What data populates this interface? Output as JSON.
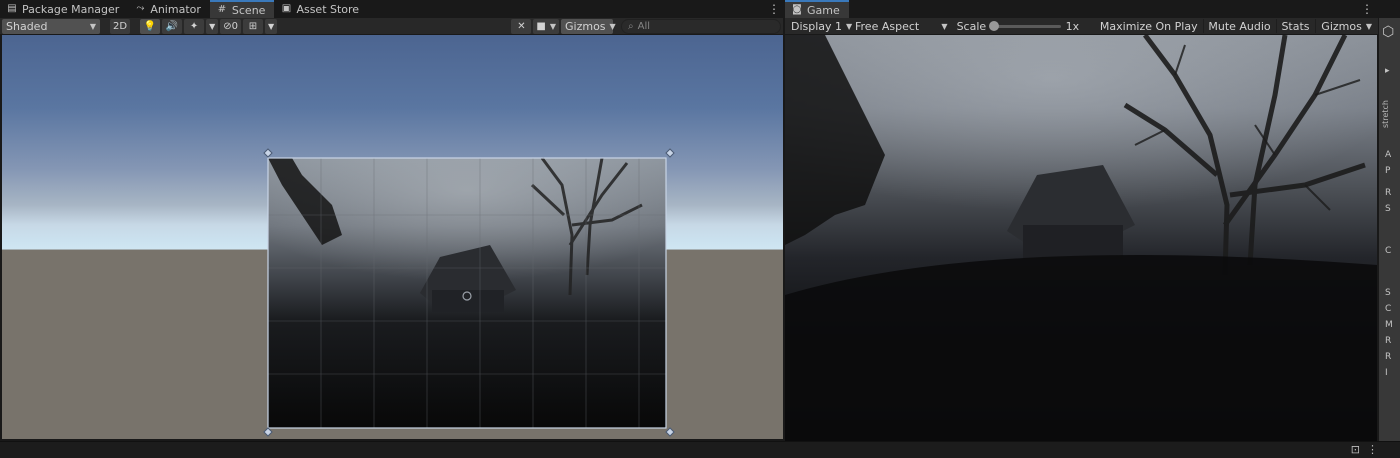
{
  "tabs": {
    "left": [
      {
        "label": "Package Manager",
        "icon": "package-icon"
      },
      {
        "label": "Animator",
        "icon": "animator-icon"
      },
      {
        "label": "Scene",
        "icon": "scene-grid-icon",
        "active": true
      },
      {
        "label": "Asset Store",
        "icon": "store-icon"
      }
    ],
    "game": {
      "label": "Game",
      "icon": "gamepad-icon"
    }
  },
  "scene_toolbar": {
    "shading_mode": "Shaded",
    "two_d": "2D",
    "hidden_count": "0",
    "gizmos": "Gizmos",
    "search_placeholder": "All"
  },
  "game_toolbar": {
    "display": "Display 1",
    "aspect": "Free Aspect",
    "scale_label": "Scale",
    "scale_value": "1x",
    "scale_level": 0.0,
    "maximize": "Maximize On Play",
    "mute": "Mute Audio",
    "stats": "Stats",
    "gizmos": "Gizmos"
  },
  "inspector": {
    "stretch_label": "stretch",
    "rows": [
      "A",
      "P",
      "R",
      "S",
      "C",
      "S",
      "C",
      "M",
      "R",
      "R",
      "I"
    ]
  },
  "colors": {
    "accent": "#3a79bb",
    "panel": "#383838",
    "toolbar": "#282828",
    "ground": "#78736b"
  }
}
